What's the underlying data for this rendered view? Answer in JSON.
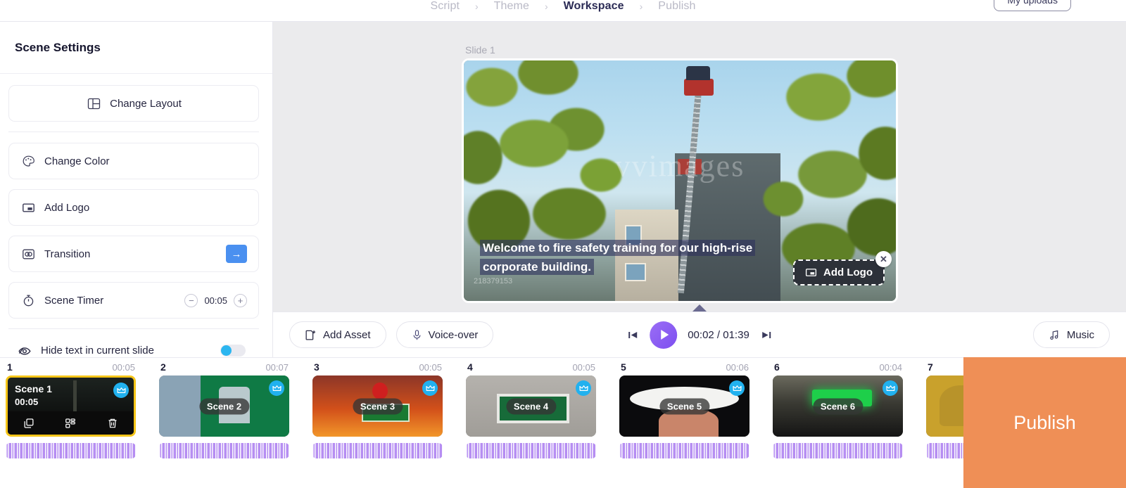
{
  "topbar": {
    "breadcrumb": [
      {
        "label": "Script",
        "active": false
      },
      {
        "label": "Theme",
        "active": false
      },
      {
        "label": "Workspace",
        "active": true
      },
      {
        "label": "Publish",
        "active": false
      }
    ],
    "separator": "›",
    "uploads_label": "My uploads"
  },
  "sidebar": {
    "title": "Scene Settings",
    "change_layout": "Change Layout",
    "change_color": "Change Color",
    "add_logo": "Add Logo",
    "transition": "Transition",
    "transition_arrow": "→",
    "scene_timer": "Scene Timer",
    "scene_timer_value": "00:05",
    "minus": "−",
    "plus": "+",
    "hide_text": "Hide text in current slide",
    "hide_text_enabled": false
  },
  "canvas": {
    "slide_label": "Slide 1",
    "caption_line1": "Welcome to fire safety training for our high-rise",
    "caption_line2": "corporate building.",
    "watermark": "vvimages",
    "stock_id": "218379153",
    "logo_chip_label": "Add Logo",
    "close_icon": "✕"
  },
  "playbar": {
    "add_asset": "Add Asset",
    "voice_over": "Voice-over",
    "current_time": "00:02",
    "total_time": "01:39",
    "time_display": "00:02 / 01:39",
    "music": "Music"
  },
  "timeline": {
    "scenes": [
      {
        "num": "1",
        "duration": "00:05",
        "tag": "Scene 1",
        "selected": true,
        "premium": true,
        "art": "art-1"
      },
      {
        "num": "2",
        "duration": "00:07",
        "tag": "Scene 2",
        "selected": false,
        "premium": true,
        "art": "art-2"
      },
      {
        "num": "3",
        "duration": "00:05",
        "tag": "Scene 3",
        "selected": false,
        "premium": true,
        "art": "art-3"
      },
      {
        "num": "4",
        "duration": "00:05",
        "tag": "Scene 4",
        "selected": false,
        "premium": true,
        "art": "art-4"
      },
      {
        "num": "5",
        "duration": "00:06",
        "tag": "Scene 5",
        "selected": false,
        "premium": true,
        "art": "art-5"
      },
      {
        "num": "6",
        "duration": "00:04",
        "tag": "Scene 6",
        "selected": false,
        "premium": true,
        "art": "art-6"
      },
      {
        "num": "7",
        "duration": "",
        "tag": "",
        "selected": false,
        "premium": false,
        "art": "art-7"
      }
    ],
    "selected_scene_title": "Scene 1",
    "selected_scene_time": "00:05"
  },
  "publish": {
    "label": "Publish"
  },
  "colors": {
    "accent_purple": "#7d4ff0",
    "transition_blue": "#4a90f0",
    "toggle_blue": "#2cb6f0",
    "crown_blue": "#21b1ef",
    "selected_border": "#f5c518",
    "publish_orange": "#ef8f56",
    "waveform_purple": "#b68ef2",
    "canvas_bg": "#ebebed"
  }
}
